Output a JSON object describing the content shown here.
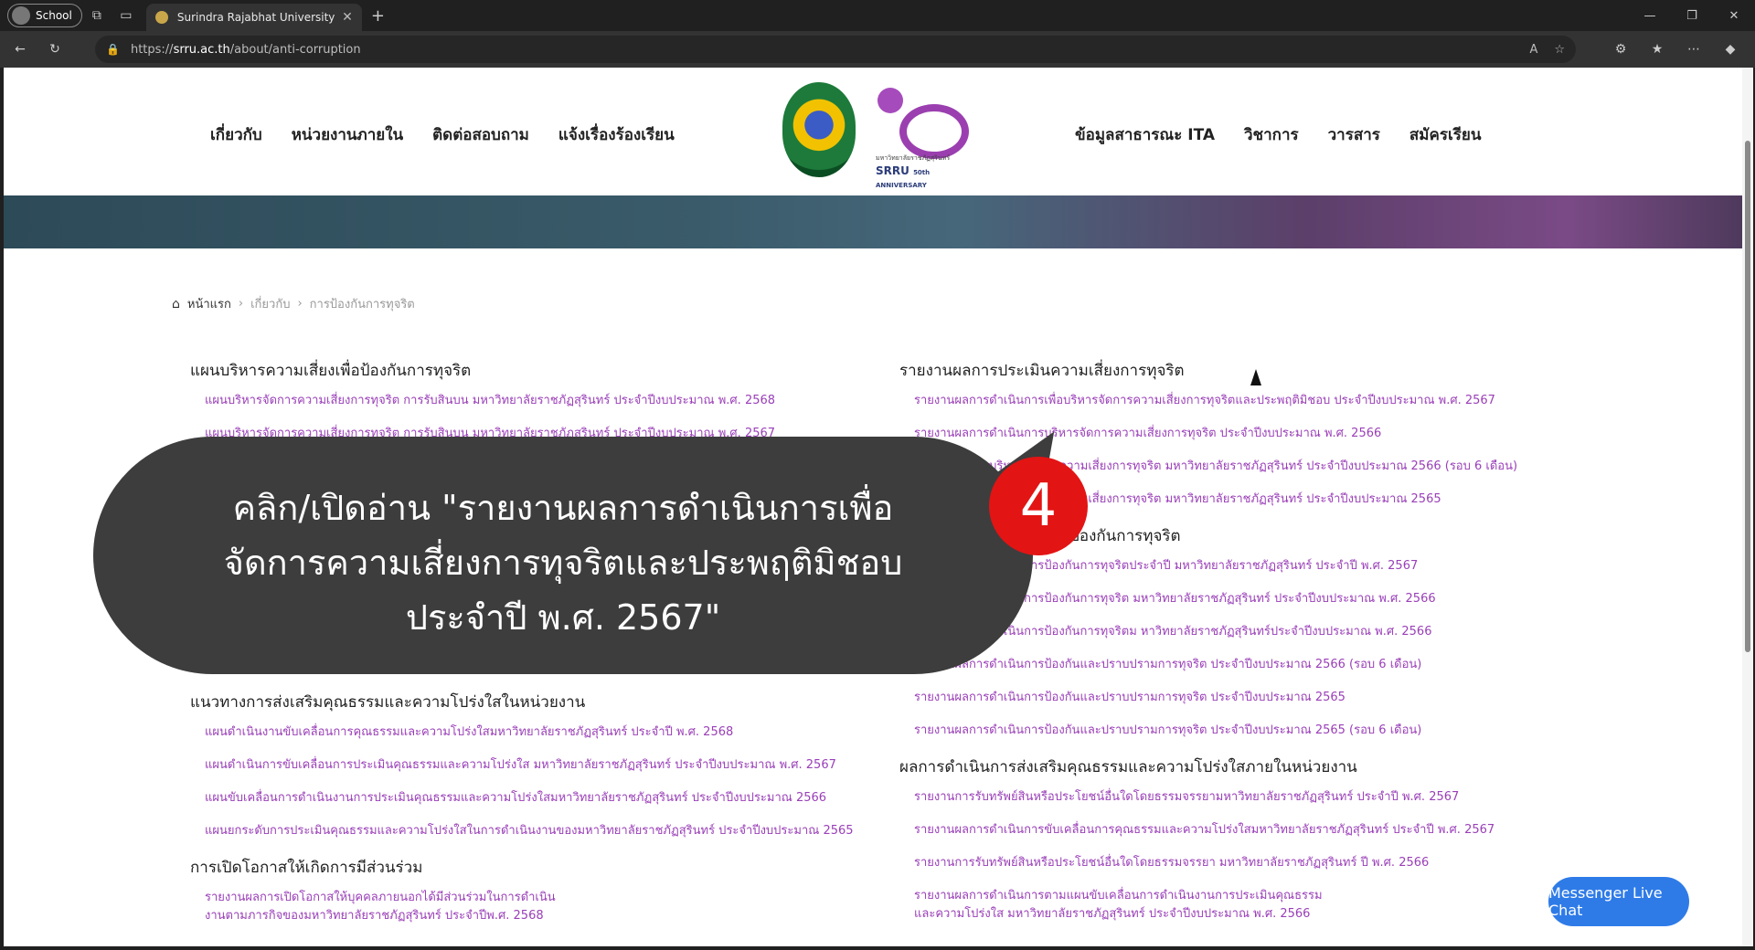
{
  "browser": {
    "profile_label": "School",
    "tab_title": "Surindra Rajabhat University | มห",
    "url_host": "srru.ac.th",
    "url_path": "/about/anti-corruption",
    "url_prefix": "https://"
  },
  "nav": {
    "left": [
      "เกี่ยวกับ",
      "หน่วยงานภายใน",
      "ติดต่อสอบถาม",
      "แจ้งเรื่องร้องเรียน"
    ],
    "right": [
      "ข้อมูลสาธารณะ ITA",
      "วิชาการ",
      "วารสาร",
      "สมัครเรียน"
    ]
  },
  "logo": {
    "srru": "SRRU",
    "anniversary": "50th ANNIVERSARY",
    "sub": "มหาวิทยาลัยราชภัฏสุรินทร์"
  },
  "breadcrumb": {
    "home": "หน้าแรก",
    "level1": "เกี่ยวกับ",
    "level2": "การป้องกันการทุจริต"
  },
  "left_column": {
    "sec1_title": "แผนบริหารความเสี่ยงเพื่อป้องกันการทุจริต",
    "sec1_links": [
      "แผนบริหารจัดการความเสี่ยงการทุจริต การรับสินบน มหาวิทยาลัยราชภัฏสุรินทร์ ประจำปีงบประมาณ พ.ศ. 2568",
      "แผนบริหารจัดการความเสี่ยงการทุจริต การรับสินบน มหาวิทยาลัยราชภัฏสุรินทร์ ประจำปีงบประมาณ พ.ศ. 2567"
    ],
    "sec2_title": "แนวทางการส่งเสริมคุณธรรมและความโปร่งใสในหน่วยงาน",
    "sec2_links": [
      "แผนดำเนินงานขับเคลื่อนการคุณธรรมและความโปร่งใสมหาวิทยาลัยราชภัฏสุรินทร์ ประจำปี พ.ศ. 2568",
      "แผนดำเนินการขับเคลื่อนการประเมินคุณธรรมและความโปร่งใส มหาวิทยาลัยราชภัฏสุรินทร์ ประจำปีงบประมาณ พ.ศ. 2567",
      "แผนขับเคลื่อนการดำเนินงานการประเมินคุณธรรมและความโปร่งใสมหาวิทยาลัยราชภัฏสุรินทร์ ประจำปีงบประมาณ 2566",
      "แผนยกระดับการประเมินคุณธรรมและความโปร่งใสในการดำเนินงานของมหาวิทยาลัยราชภัฏสุรินทร์ ประจำปีงบประมาณ 2565"
    ],
    "sec3_title": "การเปิดโอกาสให้เกิดการมีส่วนร่วม",
    "sec3_link_line1": "รายงานผลการเปิดโอกาสให้บุคคลภายนอกได้มีส่วนร่วมในการดำเนิน",
    "sec3_link_line2": "งานตามภารกิจของมหาวิทยาลัยราชภัฏสุรินทร์ ประจำปีพ.ศ. 2568"
  },
  "right_column": {
    "sec1_title": "รายงานผลการประเมินความเสี่ยงการทุจริต",
    "sec1_links": [
      "รายงานผลการดำเนินการเพื่อบริหารจัดการความเสี่ยงการทุจริตและประพฤติมิชอบ ประจำปีงบประมาณ พ.ศ. 2567",
      "รายงานผลการดำเนินการบริหารจัดการความเสี่ยงการทุจริต ประจำปีงบประมาณ พ.ศ. 2566",
      "รายงานผลการบริหารจัดการความเสี่ยงการทุจริต มหาวิทยาลัยราชภัฏสุรินทร์ ประจำปีงบประมาณ 2566 (รอบ 6 เดือน)",
      "รายงานผลการบริหารจัดการความเสี่ยงการทุจริต มหาวิทยาลัยราชภัฏสุรินทร์ ประจำปีงบประมาณ 2565"
    ],
    "sec2_title": "รายงานผลการดำเนินการป้องกันการทุจริต",
    "sec2_links": [
      "รายงานผลการดำเนินการป้องกันการทุจริตประจำปี มหาวิทยาลัยราชภัฏสุรินทร์ ประจำปี พ.ศ. 2567",
      "รายงานผลการดำเนินการป้องกันการทุจริต มหาวิทยาลัยราชภัฏสุรินทร์ ประจำปีงบประมาณ พ.ศ. 2566",
      "รายงานผลการดำเนินการป้องกันการทุจริตม หาวิทยาลัยราชภัฏสุรินทร์ประจำปีงบประมาณ พ.ศ. 2566",
      "รายงานผลการดำเนินการป้องกันและปราบปรามการทุจริต ประจำปีงบประมาณ 2566 (รอบ 6 เดือน)",
      "รายงานผลการดำเนินการป้องกันและปราบปรามการทุจริต ประจำปีงบประมาณ 2565",
      "รายงานผลการดำเนินการป้องกันและปราบปรามการทุจริต ประจำปีงบประมาณ 2565 (รอบ 6 เดือน)"
    ],
    "sec3_title": "ผลการดำเนินการส่งเสริมคุณธรรมและความโปร่งใสภายในหน่วยงาน",
    "sec3_links": [
      "รายงานการรับทรัพย์สินหรือประโยชน์อื่นใดโดยธรรมจรรยามหาวิทยาลัยราชภัฏสุรินทร์ ประจำปี พ.ศ. 2567",
      "รายงานผลการดำเนินการขับเคลื่อนการคุณธรรมและความโปร่งใสมหาวิทยาลัยราชภัฏสุรินทร์ ประจำปี พ.ศ. 2567",
      "รายงานการรับทรัพย์สินหรือประโยชน์อื่นใดโดยธรรมจรรยา มหาวิทยาลัยราชภัฏสุรินทร์ ปี พ.ศ. 2566"
    ],
    "sec3_last_line1": "รายงานผลการดำเนินการตามแผนขับเคลื่อนการดำเนินงานการประเมินคุณธรรม",
    "sec3_last_line2": "และความโปร่งใส มหาวิทยาลัยราชภัฏสุรินทร์ ประจำปีงบประมาณ พ.ศ. 2566"
  },
  "callout": {
    "line1": "คลิก/เปิดอ่าน  \"รายงานผลการดำเนินการเพื่อ",
    "line2": "จัดการความเสี่ยงการทุจริตและประพฤติมิชอบ",
    "line3": "ประจำปี พ.ศ. 2567\"",
    "step": "4"
  },
  "chat_button": "Messenger Live Chat",
  "colors": {
    "link": "#9a3fb8",
    "badge": "#e31414",
    "chat": "#2e7be8",
    "callout_bg": "#3d3d3d"
  }
}
